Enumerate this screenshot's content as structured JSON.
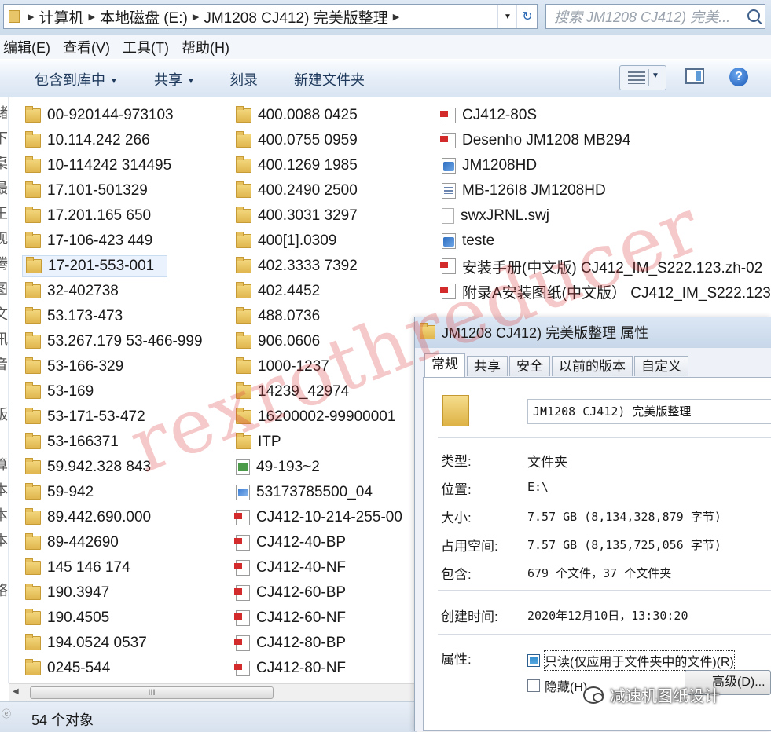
{
  "address": {
    "crumbs": [
      "计算机",
      "本地磁盘 (E:)",
      "JM1208 CJ412) 完美版整理"
    ],
    "search_placeholder": "搜索 JM1208 CJ412) 完美..."
  },
  "menu": [
    "编辑(E)",
    "查看(V)",
    "工具(T)",
    "帮助(H)"
  ],
  "toolbar": {
    "include_library": "包含到库中",
    "share": "共享",
    "burn": "刻录",
    "new_folder": "新建文件夹",
    "help": "?"
  },
  "nav_chars": [
    "储",
    "下",
    "桌",
    "最",
    "王",
    "视",
    "腾",
    "图",
    "文",
    "讯",
    "音",
    "",
    "版",
    "",
    "算",
    "本",
    "本",
    "本",
    "",
    "络"
  ],
  "files": {
    "col1": [
      {
        "name": "00-920144-973103",
        "icon": "folder-icon"
      },
      {
        "name": "10.114.242 266",
        "icon": "folder-icon"
      },
      {
        "name": "10-114242 314495",
        "icon": "folder-icon"
      },
      {
        "name": "17.101-501329",
        "icon": "folder-icon"
      },
      {
        "name": "17.201.165 650",
        "icon": "folder-icon"
      },
      {
        "name": "17-106-423 449",
        "icon": "folder-icon"
      },
      {
        "name": "17-201-553-001",
        "icon": "folder-icon",
        "selected": true
      },
      {
        "name": "32-402738",
        "icon": "folder-icon"
      },
      {
        "name": "53.173-473",
        "icon": "folder-icon"
      },
      {
        "name": "53.267.179  53-466-999",
        "icon": "folder-icon"
      },
      {
        "name": "53-166-329",
        "icon": "folder-icon"
      },
      {
        "name": "53-169",
        "icon": "folder-icon"
      },
      {
        "name": "53-171-53-472",
        "icon": "folder-icon"
      },
      {
        "name": "53-166371",
        "icon": "folder-icon"
      },
      {
        "name": "59.942.328 843",
        "icon": "folder-icon"
      },
      {
        "name": "59-942",
        "icon": "folder-icon"
      },
      {
        "name": "89.442.690.000",
        "icon": "folder-icon"
      },
      {
        "name": "89-442690",
        "icon": "folder-icon"
      },
      {
        "name": "145 146 174",
        "icon": "folder-icon"
      },
      {
        "name": "190.3947",
        "icon": "folder-icon"
      },
      {
        "name": "190.4505",
        "icon": "folder-icon"
      },
      {
        "name": "194.0524 0537",
        "icon": "folder-icon"
      },
      {
        "name": "0245-544",
        "icon": "folder-icon"
      }
    ],
    "col2": [
      {
        "name": "400.0088 0425",
        "icon": "folder-icon"
      },
      {
        "name": "400.0755 0959",
        "icon": "folder-icon"
      },
      {
        "name": "400.1269 1985",
        "icon": "folder-icon"
      },
      {
        "name": "400.2490 2500",
        "icon": "folder-icon"
      },
      {
        "name": "400.3031 3297",
        "icon": "folder-icon"
      },
      {
        "name": "400[1].0309",
        "icon": "folder-icon"
      },
      {
        "name": "402.3333 7392",
        "icon": "folder-icon"
      },
      {
        "name": "402.4452",
        "icon": "folder-icon"
      },
      {
        "name": "488.0736",
        "icon": "folder-icon"
      },
      {
        "name": "906.0606",
        "icon": "folder-icon"
      },
      {
        "name": "1000-1237",
        "icon": "folder-icon"
      },
      {
        "name": "14239_42974",
        "icon": "folder-icon"
      },
      {
        "name": "16200002-99900001",
        "icon": "folder-icon"
      },
      {
        "name": "ITP",
        "icon": "folder-icon"
      },
      {
        "name": "49-193~2",
        "icon": "spreadsheet-icon"
      },
      {
        "name": "53173785500_04",
        "icon": "image-file-icon"
      },
      {
        "name": "CJ412-10-214-255-00",
        "icon": "pdf-icon"
      },
      {
        "name": "CJ412-40-BP",
        "icon": "pdf-icon"
      },
      {
        "name": "CJ412-40-NF",
        "icon": "pdf-icon"
      },
      {
        "name": "CJ412-60-BP",
        "icon": "pdf-icon"
      },
      {
        "name": "CJ412-60-NF",
        "icon": "pdf-icon"
      },
      {
        "name": "CJ412-80-BP",
        "icon": "pdf-icon"
      },
      {
        "name": "CJ412-80-NF",
        "icon": "pdf-icon"
      }
    ],
    "col3": [
      {
        "name": "CJ412-80S",
        "icon": "pdf-icon"
      },
      {
        "name": "Desenho JM1208 MB294",
        "icon": "pdf-icon"
      },
      {
        "name": "JM1208HD",
        "icon": "assembly-file-icon"
      },
      {
        "name": "MB-126I8 JM1208HD",
        "icon": "document-icon"
      },
      {
        "name": "swxJRNL.swj",
        "icon": "blank-file-icon"
      },
      {
        "name": "teste",
        "icon": "assembly-file-icon"
      },
      {
        "name": "安装手册(中文版) CJ412_IM_S222.123.zh-02",
        "icon": "pdf-icon"
      },
      {
        "name": "附录A安装图纸(中文版）  CJ412_IM_S222.123.",
        "icon": "pdf-icon"
      }
    ]
  },
  "status": {
    "count": "54 个对象",
    "scroll_grip": "III"
  },
  "properties": {
    "title": "JM1208 CJ412) 完美版整理 属性",
    "tabs": [
      "常规",
      "共享",
      "安全",
      "以前的版本",
      "自定义"
    ],
    "active_tab": "常规",
    "name": "JM1208 CJ412) 完美版整理",
    "type_label": "类型:",
    "type_value": "文件夹",
    "location_label": "位置:",
    "location_value": "E:\\",
    "size_label": "大小:",
    "size_value": "7.57 GB (8,134,328,879 字节)",
    "disk_label": "占用空间:",
    "disk_value": "7.57 GB (8,135,725,056 字节)",
    "contains_label": "包含:",
    "contains_value": "679 个文件，37 个文件夹",
    "created_label": "创建时间:",
    "created_value": "2020年12月10日，13:30:20",
    "attributes_label": "属性:",
    "readonly_label": "只读(仅应用于文件夹中的文件)(R)",
    "hidden_label": "隐藏(H)",
    "advanced_label": "高级(D)..."
  },
  "watermark_text": "rexrothreducer",
  "wechat_text": "减速机图纸设计"
}
